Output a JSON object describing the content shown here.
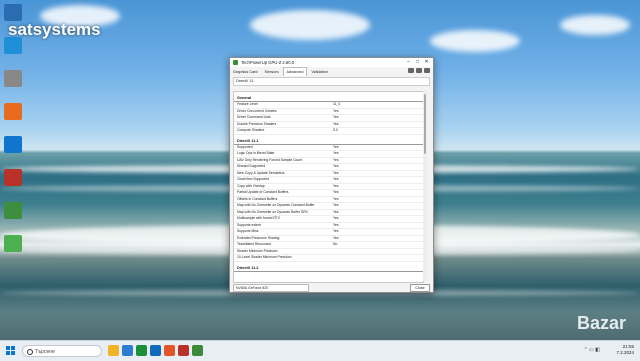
{
  "desktop": {
    "watermark": "satsystems",
    "corner_mark": "Bazar",
    "icons": [
      {
        "label": "",
        "color": "#2b6cb0"
      },
      {
        "label": "",
        "color": "#1f8fd8"
      },
      {
        "label": "",
        "color": "#888888"
      },
      {
        "label": "",
        "color": "#e86b1f"
      },
      {
        "label": "",
        "color": "#0f75cf"
      },
      {
        "label": "",
        "color": "#b8322a"
      },
      {
        "label": "",
        "color": "#3d8f3d"
      },
      {
        "label": "",
        "color": "#4caf50"
      }
    ]
  },
  "window": {
    "title": "TechPowerUp GPU-Z 2.60.0",
    "controls": {
      "minimize": "–",
      "maximize": "□",
      "close": "✕"
    },
    "tabs": [
      "Graphics Card",
      "Sensors",
      "Advanced",
      "Validation"
    ],
    "active_tab": "Advanced",
    "selector": "DirectX 11",
    "sections": [
      {
        "title": "General",
        "rows": [
          {
            "k": "Feature Level",
            "v": "11_0"
          },
          {
            "k": "Driver Concurrent Creates",
            "v": "Yes"
          },
          {
            "k": "Driver Command Lists",
            "v": "Yes"
          },
          {
            "k": "Double Precision Shaders",
            "v": "Yes"
          },
          {
            "k": "Compute Shaders",
            "v": "5.0"
          }
        ]
      },
      {
        "title": "DirectX 11.1",
        "rows": [
          {
            "k": "Supported",
            "v": "Yes"
          },
          {
            "k": "Logic Ops in Blend State",
            "v": "Yes"
          },
          {
            "k": "UAV Only Rendering Forced Sample Count",
            "v": "Yes"
          },
          {
            "k": "Discard Supported",
            "v": "Yes"
          },
          {
            "k": "New Copy & Update Semantics",
            "v": "Yes"
          },
          {
            "k": "ClearView Supported",
            "v": "Yes"
          },
          {
            "k": "Copy with Overlap",
            "v": "Yes"
          },
          {
            "k": "Partial Update of Constant Buffers",
            "v": "Yes"
          },
          {
            "k": "Offsets in Constant Buffers",
            "v": "Yes"
          },
          {
            "k": "Map with No Overwrite on Dynamic Constant Buffer",
            "v": "Yes"
          },
          {
            "k": "Map with No Overwrite on Dynamic Buffer SRV",
            "v": "Yes"
          },
          {
            "k": "Multisample with forced RTV",
            "v": "Yes"
          },
          {
            "k": "Supports extent",
            "v": "Yes"
          },
          {
            "k": "Supports Miss",
            "v": "Yes"
          },
          {
            "k": "Extended Resource Sharing",
            "v": "Yes"
          },
          {
            "k": "Tessellated Resources",
            "v": "No"
          },
          {
            "k": "Shader Minimum Precision",
            "v": ""
          },
          {
            "k": "10-Level Shader Minimum Precision",
            "v": ""
          }
        ]
      },
      {
        "title": "DirectX 11.2",
        "rows": []
      }
    ],
    "gpu_select": "NVIDIA GeForce 820",
    "close_label": "Close"
  },
  "taskbar": {
    "search_placeholder": "Търсене",
    "apps": [
      {
        "color": "#f0b429"
      },
      {
        "color": "#2d7dd2"
      },
      {
        "color": "#1b8f3a"
      },
      {
        "color": "#0f6cbd"
      },
      {
        "color": "#e2552b"
      },
      {
        "color": "#b8322a"
      },
      {
        "color": "#3a8a3a"
      }
    ],
    "time": "21:55",
    "date": "7.2.2024"
  }
}
